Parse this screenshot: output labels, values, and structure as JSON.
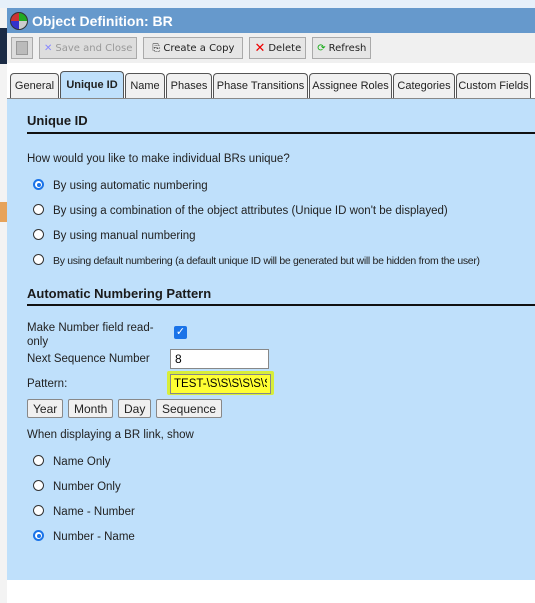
{
  "window": {
    "title": "Object Definition: BR"
  },
  "toolbar": {
    "save_close": "Save and Close",
    "create_copy": "Create a Copy",
    "delete": "Delete",
    "refresh": "Refresh"
  },
  "tabs": [
    "General",
    "Unique ID",
    "Name",
    "Phases",
    "Phase Transitions",
    "Assignee Roles",
    "Categories",
    "Custom Fields"
  ],
  "unique_id": {
    "heading": "Unique ID",
    "question": "How would you like to make individual BRs unique?",
    "options": [
      "By using automatic numbering",
      "By using a combination of the object attributes (Unique ID won't be displayed)",
      "By using manual numbering",
      "By using default numbering (a default unique ID will be generated but will be hidden from the user)"
    ],
    "selected": 0
  },
  "pattern": {
    "heading": "Automatic Numbering Pattern",
    "readonly_label": "Make Number field read-only",
    "readonly_checked": true,
    "next_seq_label": "Next Sequence Number",
    "next_seq_value": "8",
    "pattern_label": "Pattern:",
    "pattern_value": "TEST-\\S\\S\\S\\S\\S\\S",
    "buttons": [
      "Year",
      "Month",
      "Day",
      "Sequence"
    ]
  },
  "link": {
    "label": "When displaying a BR link, show",
    "options": [
      "Name Only",
      "Number Only",
      "Name - Number",
      "Number - Name"
    ],
    "selected": 3
  },
  "colors": {
    "title_bar": "#6699cc",
    "panel": "#bfe0fb",
    "pattern_highlight": "#ffff33"
  }
}
